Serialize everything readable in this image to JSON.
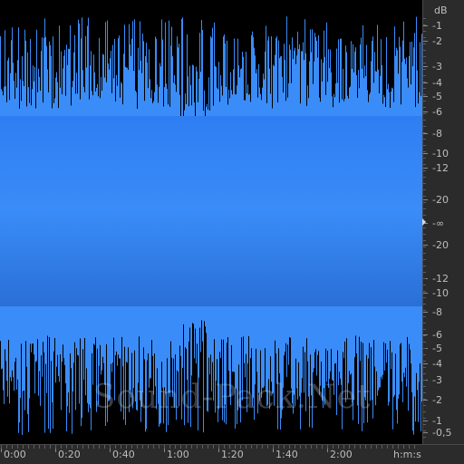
{
  "db_ruler": {
    "unit_label": "dB",
    "labels": [
      "-1",
      "-2",
      "-3",
      "-4",
      "-5",
      "-6",
      "-8",
      "-10",
      "-12",
      "-20",
      "-∞",
      "-20",
      "-12",
      "-10",
      "-8",
      "-6",
      "-5",
      "-4",
      "-3",
      "-2",
      "-1",
      "-0,5"
    ]
  },
  "time_ruler": {
    "labels": [
      "0:00",
      "0:20",
      "0:40",
      "1:00",
      "1:20",
      "1:40",
      "2:00"
    ],
    "unit_label": "h:m:s"
  },
  "watermark": {
    "text": "Sound-Pack.Net"
  },
  "colors": {
    "wave_top": "#2e7ef2",
    "wave_mid": "#3a8cf8",
    "wave_bottom": "#2a6fd6",
    "background": "#000000",
    "ruler_bg": "#2b2b2b",
    "ruler_text": "#bdbdbd"
  }
}
